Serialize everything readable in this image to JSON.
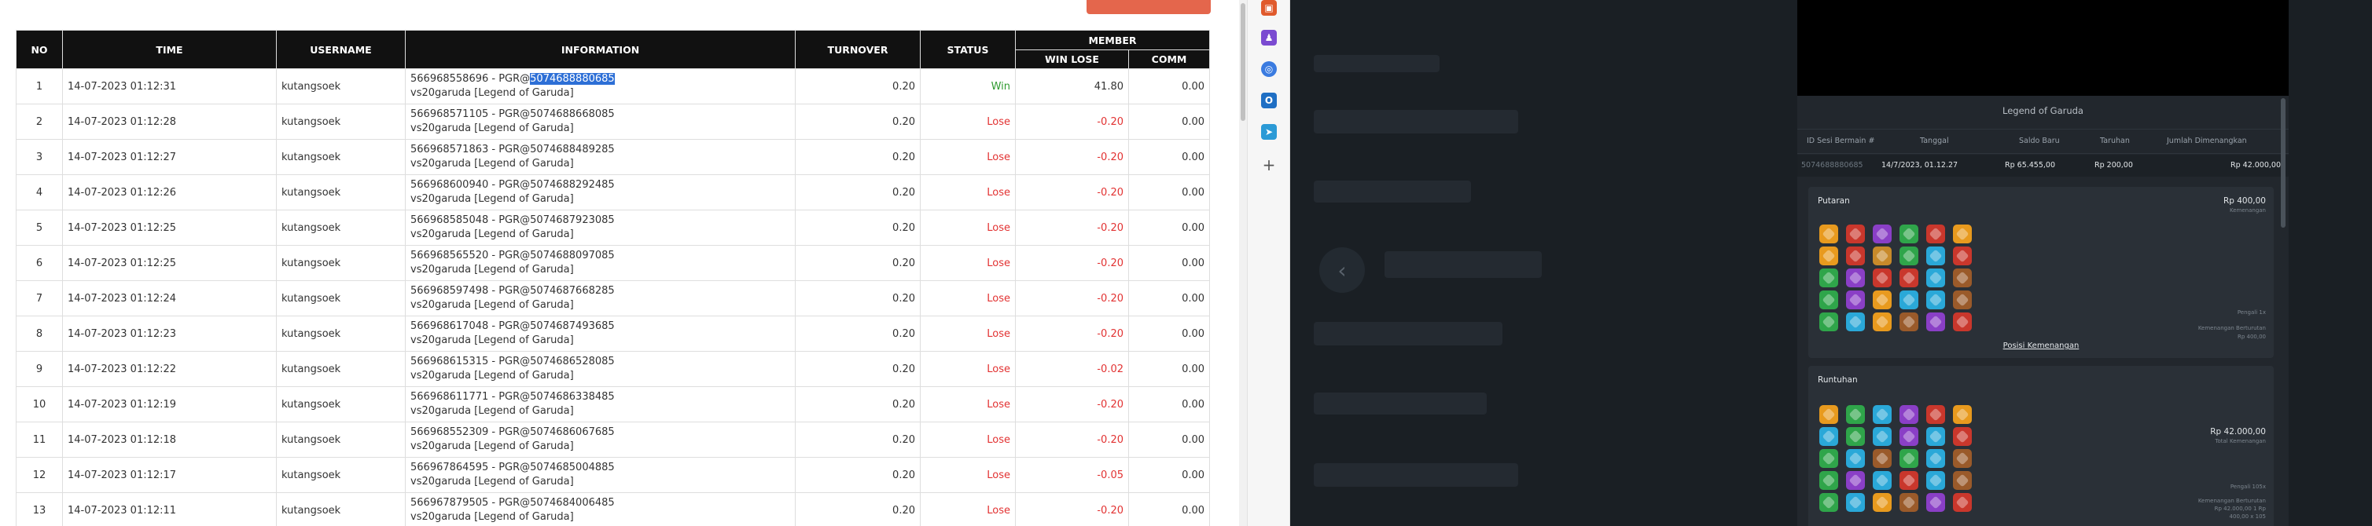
{
  "table": {
    "headers": {
      "no": "NO",
      "time": "TIME",
      "username": "USERNAME",
      "information": "INFORMATION",
      "turnover": "TURNOVER",
      "status": "STATUS",
      "member": "MEMBER",
      "win_lose": "WIN LOSE",
      "comm": "COMM"
    },
    "rows": [
      {
        "no": "1",
        "time": "14-07-2023 01:12:31",
        "username": "kutangsoek",
        "info_prefix": "566968558696 - PGR@",
        "info_id": "5074688880685",
        "info_game": "vs20garuda [Legend of Garuda]",
        "turnover": "0.20",
        "status": "Win",
        "win_lose": "41.80",
        "comm": "0.00"
      },
      {
        "no": "2",
        "time": "14-07-2023 01:12:28",
        "username": "kutangsoek",
        "info_prefix": "566968571105 - PGR@",
        "info_id": "5074688668085",
        "info_game": "vs20garuda [Legend of Garuda]",
        "turnover": "0.20",
        "status": "Lose",
        "win_lose": "-0.20",
        "comm": "0.00"
      },
      {
        "no": "3",
        "time": "14-07-2023 01:12:27",
        "username": "kutangsoek",
        "info_prefix": "566968571863 - PGR@",
        "info_id": "5074688489285",
        "info_game": "vs20garuda [Legend of Garuda]",
        "turnover": "0.20",
        "status": "Lose",
        "win_lose": "-0.20",
        "comm": "0.00"
      },
      {
        "no": "4",
        "time": "14-07-2023 01:12:26",
        "username": "kutangsoek",
        "info_prefix": "566968600940 - PGR@",
        "info_id": "5074688292485",
        "info_game": "vs20garuda [Legend of Garuda]",
        "turnover": "0.20",
        "status": "Lose",
        "win_lose": "-0.20",
        "comm": "0.00"
      },
      {
        "no": "5",
        "time": "14-07-2023 01:12:25",
        "username": "kutangsoek",
        "info_prefix": "566968585048 - PGR@",
        "info_id": "5074687923085",
        "info_game": "vs20garuda [Legend of Garuda]",
        "turnover": "0.20",
        "status": "Lose",
        "win_lose": "-0.20",
        "comm": "0.00"
      },
      {
        "no": "6",
        "time": "14-07-2023 01:12:25",
        "username": "kutangsoek",
        "info_prefix": "566968565520 - PGR@",
        "info_id": "5074688097085",
        "info_game": "vs20garuda [Legend of Garuda]",
        "turnover": "0.20",
        "status": "Lose",
        "win_lose": "-0.20",
        "comm": "0.00"
      },
      {
        "no": "7",
        "time": "14-07-2023 01:12:24",
        "username": "kutangsoek",
        "info_prefix": "566968597498 - PGR@",
        "info_id": "5074687668285",
        "info_game": "vs20garuda [Legend of Garuda]",
        "turnover": "0.20",
        "status": "Lose",
        "win_lose": "-0.20",
        "comm": "0.00"
      },
      {
        "no": "8",
        "time": "14-07-2023 01:12:23",
        "username": "kutangsoek",
        "info_prefix": "566968617048 - PGR@",
        "info_id": "5074687493685",
        "info_game": "vs20garuda [Legend of Garuda]",
        "turnover": "0.20",
        "status": "Lose",
        "win_lose": "-0.20",
        "comm": "0.00"
      },
      {
        "no": "9",
        "time": "14-07-2023 01:12:22",
        "username": "kutangsoek",
        "info_prefix": "566968615315 - PGR@",
        "info_id": "5074686528085",
        "info_game": "vs20garuda [Legend of Garuda]",
        "turnover": "0.20",
        "status": "Lose",
        "win_lose": "-0.02",
        "comm": "0.00"
      },
      {
        "no": "10",
        "time": "14-07-2023 01:12:19",
        "username": "kutangsoek",
        "info_prefix": "566968611771 - PGR@",
        "info_id": "5074686338485",
        "info_game": "vs20garuda [Legend of Garuda]",
        "turnover": "0.20",
        "status": "Lose",
        "win_lose": "-0.20",
        "comm": "0.00"
      },
      {
        "no": "11",
        "time": "14-07-2023 01:12:18",
        "username": "kutangsoek",
        "info_prefix": "566968552309 - PGR@",
        "info_id": "5074686067685",
        "info_game": "vs20garuda [Legend of Garuda]",
        "turnover": "0.20",
        "status": "Lose",
        "win_lose": "-0.20",
        "comm": "0.00"
      },
      {
        "no": "12",
        "time": "14-07-2023 01:12:17",
        "username": "kutangsoek",
        "info_prefix": "566967864595 - PGR@",
        "info_id": "5074685004885",
        "info_game": "vs20garuda [Legend of Garuda]",
        "turnover": "0.20",
        "status": "Lose",
        "win_lose": "-0.05",
        "comm": "0.00"
      },
      {
        "no": "13",
        "time": "14-07-2023 01:12:11",
        "username": "kutangsoek",
        "info_prefix": "566967879505 - PGR@",
        "info_id": "5074684006485",
        "info_game": "vs20garuda [Legend of Garuda]",
        "turnover": "0.20",
        "status": "Lose",
        "win_lose": "-0.20",
        "comm": "0.00"
      }
    ]
  },
  "toolbar": {
    "icons": [
      "toolbox-icon",
      "game-icon",
      "copilot-icon",
      "outlook-icon",
      "send-icon",
      "add-icon"
    ],
    "add_glyph": "+"
  },
  "history": {
    "title": "Legend of Garuda",
    "columns": {
      "round_id": "ID Sesi Bermain #",
      "date": "Tanggal",
      "new_balance": "Saldo Baru",
      "bet": "Taruhan",
      "win_amount": "Jumlah Dimenangkan"
    },
    "row": {
      "round_id": "5074688880685",
      "date": "14/7/2023, 01.12.27",
      "new_balance": "Rp 65.455,00",
      "bet": "Rp 200,00",
      "win_amount": "Rp 42.000,00"
    },
    "spin": {
      "title": "Putaran",
      "amount": "Rp 400,00",
      "amount_sub": "Kemenangan",
      "note1": "Pengali 1x",
      "note2": "Kemenangan Berturutan",
      "note3": "Rp 400,00",
      "link": "Posisi Kemenangan"
    },
    "tumble": {
      "title": "Runtuhan",
      "amount": "Rp 42.000,00",
      "amount_sub": "Total Kemenangan",
      "note1": "Pengali 105x",
      "note2": "Kemenangan Berturutan",
      "note3": "Rp 42.000,00 1 Rp",
      "note4": "400,00 x 105"
    },
    "prev_arrow": "‹"
  },
  "colors": {
    "win": "#2f9a2f",
    "lose": "#e23232",
    "header_bg": "#111111",
    "highlight": "#2d6fd6",
    "action_button": "#e4664c",
    "game_bg": "#1a1f24"
  }
}
